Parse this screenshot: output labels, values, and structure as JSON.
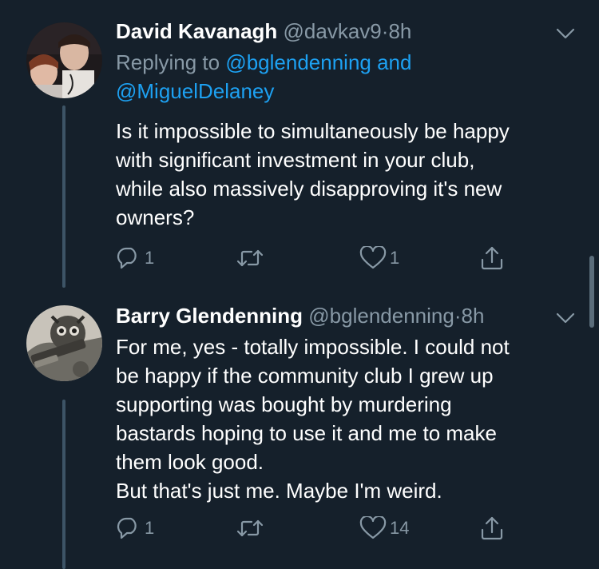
{
  "tweets": [
    {
      "display_name": "David Kavanagh",
      "handle": "@davkav9",
      "separator": "·",
      "time": "8h",
      "reply_prefix": "Replying to",
      "reply_mention_1": "@bglendenning",
      "reply_joiner": "and",
      "reply_mention_2": "@MiguelDelaney",
      "lines": [
        "Is it impossible to simultaneously be happy",
        "with significant investment in your club,",
        "while also massively disapproving it's new",
        "owners?"
      ],
      "reply_count": "1",
      "retweet_count": "",
      "like_count": "1"
    },
    {
      "display_name": "Barry Glendenning",
      "handle": "@bglendenning",
      "separator": "·",
      "time": "8h",
      "lines": [
        "For me, yes - totally impossible. I could not",
        "be happy if the community club I grew up",
        "supporting was bought by murdering",
        "bastards hoping to use it and me to make",
        "them look good.",
        "But that's just me. Maybe I'm weird."
      ],
      "reply_count": "1",
      "retweet_count": "",
      "like_count": "14"
    }
  ],
  "icons": {
    "reply": "reply-icon",
    "retweet": "retweet-icon",
    "like": "heart-icon",
    "share": "share-icon",
    "more": "chevron-down-icon"
  },
  "colors": {
    "background": "#15202b",
    "text": "#ffffff",
    "secondary": "#8899a6",
    "link": "#1da1f2",
    "thread_line": "#3d5466"
  }
}
